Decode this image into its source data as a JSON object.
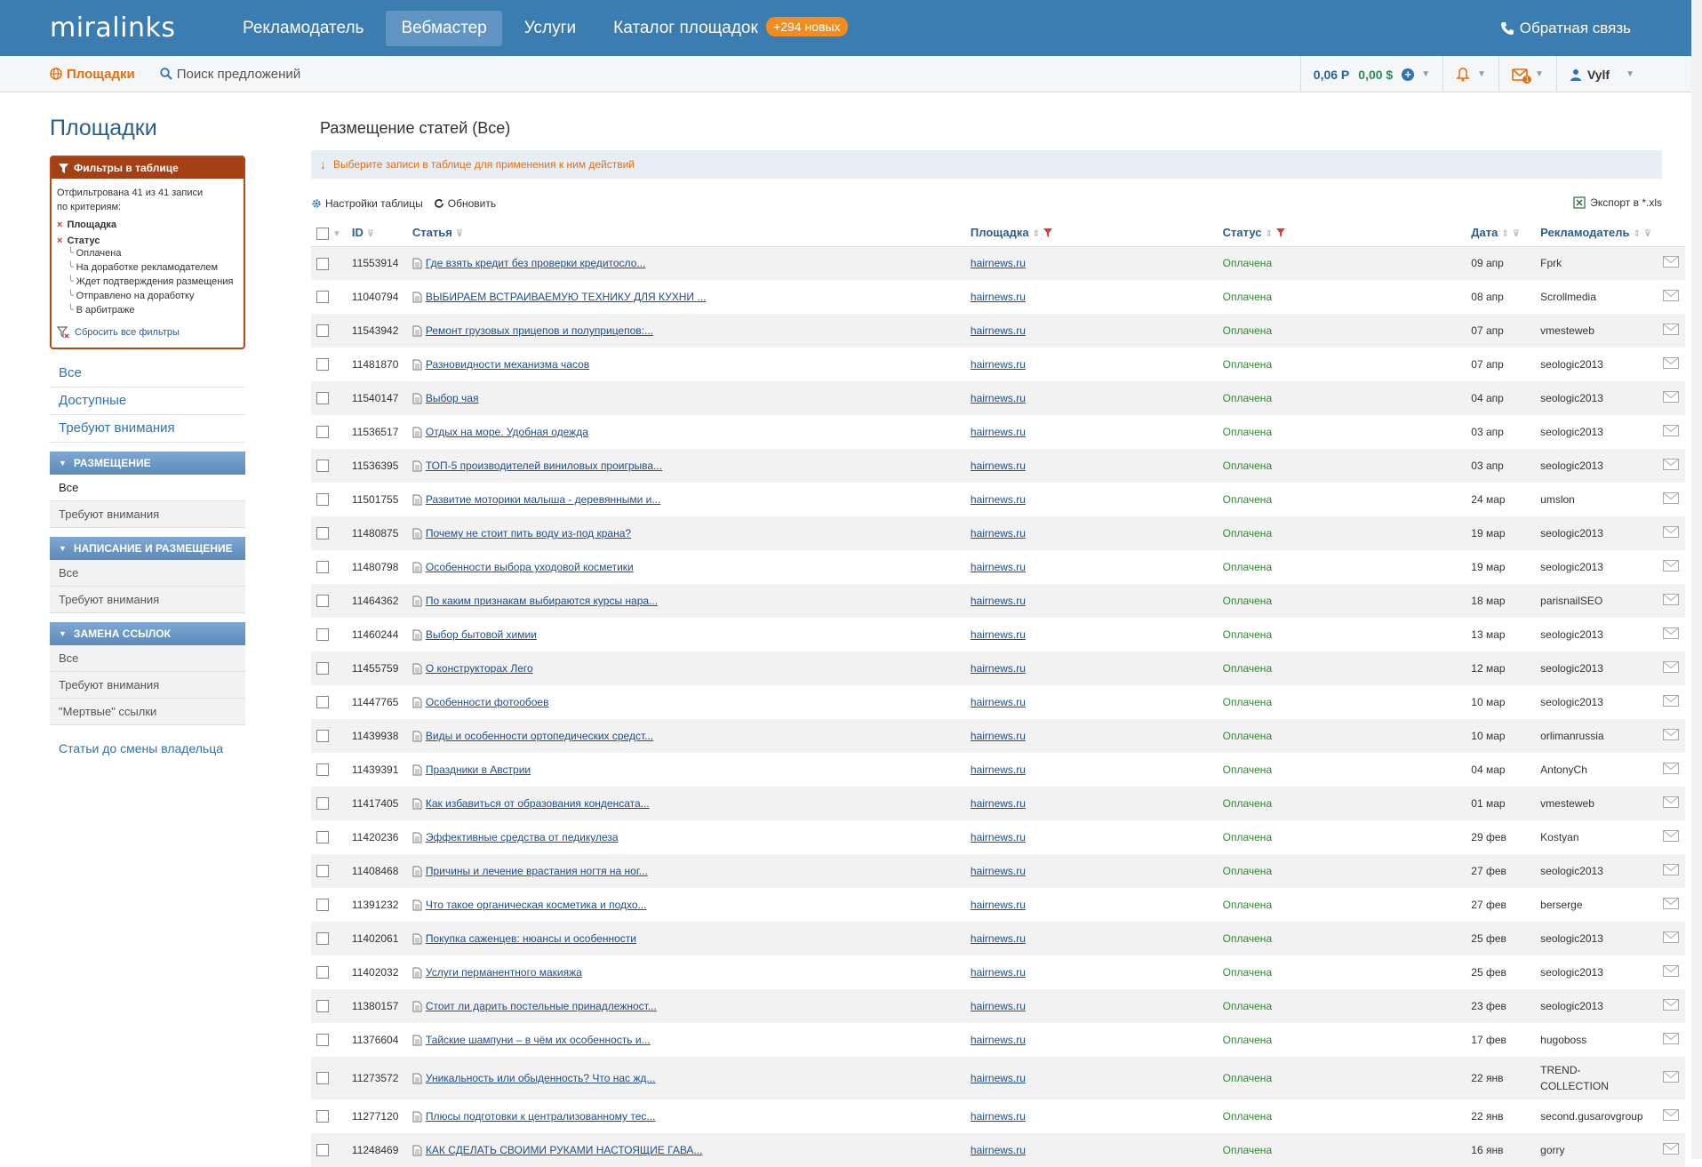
{
  "top": {
    "logo": "miralinks",
    "nav": [
      {
        "label": "Рекламодатель",
        "active": false
      },
      {
        "label": "Вебмастер",
        "active": true
      },
      {
        "label": "Услуги",
        "active": false
      },
      {
        "label": "Каталог площадок",
        "active": false
      }
    ],
    "catalog_badge": "+294 новых",
    "feedback": "Обратная связь"
  },
  "subnav": {
    "sites": "Площадки",
    "search": "Поиск предложений",
    "balance_rub": "0,06 Р",
    "balance_usd": "0,00 $",
    "mail_count": "1",
    "user": "Vylf"
  },
  "sidebar": {
    "title": "Площадки",
    "filter": {
      "title": "Фильтры в таблице",
      "info_line1": "Отфильтрована 41 из 41 записи",
      "info_line2": "по критериям:",
      "criterion1": "Площадка",
      "criterion2": "Статус",
      "statuses": [
        "Оплачена",
        "На доработке рекламодателем",
        "Ждет подтверждения размещения",
        "Отправлено на доработку",
        "В арбитраже"
      ],
      "reset": "Сбросить все фильтры"
    },
    "links": [
      "Все",
      "Доступные",
      "Требуют внимания"
    ],
    "groups": [
      {
        "title": "Размещение",
        "items": [
          "Все",
          "Требуют внимания"
        ]
      },
      {
        "title": "Написание и размещение",
        "items": [
          "Все",
          "Требуют внимания"
        ]
      },
      {
        "title": "Замена ссылок",
        "items": [
          "Все",
          "Требуют внимания",
          "\"Мертвые\" ссылки"
        ]
      }
    ],
    "extra_link": "Статьи до смены владельца"
  },
  "main": {
    "title": "Размещение статей (Все)",
    "hint": "Выберите записи в таблице для применения к ним действий",
    "table_settings": "Настройки таблицы",
    "refresh": "Обновить",
    "export": "Экспорт в *.xls",
    "columns": {
      "id": "ID",
      "article": "Статья",
      "site": "Площадка",
      "status": "Статус",
      "date": "Дата",
      "advertiser": "Рекламодатель"
    },
    "rows": [
      {
        "id": "11553914",
        "article": "Где взять кредит без проверки кредитосло...",
        "site": "hairnews.ru",
        "status": "Оплачена",
        "date": "09 апр",
        "adv": "Fprk"
      },
      {
        "id": "11040794",
        "article": "ВЫБИРАЕМ ВСТРАИВАЕМУЮ ТЕХНИКУ ДЛЯ КУХНИ ...",
        "site": "hairnews.ru",
        "status": "Оплачена",
        "date": "08 апр",
        "adv": "Scrollmedia"
      },
      {
        "id": "11543942",
        "article": "Ремонт грузовых прицепов и полуприцепов:...",
        "site": "hairnews.ru",
        "status": "Оплачена",
        "date": "07 апр",
        "adv": "vmesteweb"
      },
      {
        "id": "11481870",
        "article": "Разновидности механизма часов",
        "site": "hairnews.ru",
        "status": "Оплачена",
        "date": "07 апр",
        "adv": "seologic2013"
      },
      {
        "id": "11540147",
        "article": "Выбор чая",
        "site": "hairnews.ru",
        "status": "Оплачена",
        "date": "04 апр",
        "adv": "seologic2013"
      },
      {
        "id": "11536517",
        "article": "Отдых на море. Удобная одежда",
        "site": "hairnews.ru",
        "status": "Оплачена",
        "date": "03 апр",
        "adv": "seologic2013"
      },
      {
        "id": "11536395",
        "article": "ТОП-5 производителей виниловых проигрыва...",
        "site": "hairnews.ru",
        "status": "Оплачена",
        "date": "03 апр",
        "adv": "seologic2013"
      },
      {
        "id": "11501755",
        "article": "Развитие моторики малыша - деревянными и...",
        "site": "hairnews.ru",
        "status": "Оплачена",
        "date": "24 мар",
        "adv": "umslon"
      },
      {
        "id": "11480875",
        "article": "Почему не стоит пить воду из-под крана?",
        "site": "hairnews.ru",
        "status": "Оплачена",
        "date": "19 мар",
        "adv": "seologic2013"
      },
      {
        "id": "11480798",
        "article": "Особенности выбора уходовой косметики",
        "site": "hairnews.ru",
        "status": "Оплачена",
        "date": "19 мар",
        "adv": "seologic2013"
      },
      {
        "id": "11464362",
        "article": "По каким признакам выбираются курсы нара...",
        "site": "hairnews.ru",
        "status": "Оплачена",
        "date": "18 мар",
        "adv": "parisnailSEO"
      },
      {
        "id": "11460244",
        "article": "Выбор бытовой химии",
        "site": "hairnews.ru",
        "status": "Оплачена",
        "date": "13 мар",
        "adv": "seologic2013"
      },
      {
        "id": "11455759",
        "article": "О конструкторах Лего",
        "site": "hairnews.ru",
        "status": "Оплачена",
        "date": "12 мар",
        "adv": "seologic2013"
      },
      {
        "id": "11447765",
        "article": "Особенности фотообоев",
        "site": "hairnews.ru",
        "status": "Оплачена",
        "date": "10 мар",
        "adv": "seologic2013"
      },
      {
        "id": "11439938",
        "article": "Виды и особенности ортопедических средст...",
        "site": "hairnews.ru",
        "status": "Оплачена",
        "date": "10 мар",
        "adv": "orlimanrussia"
      },
      {
        "id": "11439391",
        "article": "Праздники в Австрии",
        "site": "hairnews.ru",
        "status": "Оплачена",
        "date": "04 мар",
        "adv": "AntonyCh"
      },
      {
        "id": "11417405",
        "article": "Как избавиться от образования конденсата...",
        "site": "hairnews.ru",
        "status": "Оплачена",
        "date": "01 мар",
        "adv": "vmesteweb"
      },
      {
        "id": "11420236",
        "article": "Эффективные средства от педикулеза",
        "site": "hairnews.ru",
        "status": "Оплачена",
        "date": "29 фев",
        "adv": "Kostyan"
      },
      {
        "id": "11408468",
        "article": "Причины и лечение врастания ногтя на ног...",
        "site": "hairnews.ru",
        "status": "Оплачена",
        "date": "27 фев",
        "adv": "seologic2013"
      },
      {
        "id": "11391232",
        "article": "Что такое органическая косметика и подхо...",
        "site": "hairnews.ru",
        "status": "Оплачена",
        "date": "27 фев",
        "adv": "berserge"
      },
      {
        "id": "11402061",
        "article": "Покупка саженцев: нюансы и особенности",
        "site": "hairnews.ru",
        "status": "Оплачена",
        "date": "25 фев",
        "adv": "seologic2013"
      },
      {
        "id": "11402032",
        "article": "Услуги перманентного макияжа",
        "site": "hairnews.ru",
        "status": "Оплачена",
        "date": "25 фев",
        "adv": "seologic2013"
      },
      {
        "id": "11380157",
        "article": "Стоит ли дарить постельные принадлежност...",
        "site": "hairnews.ru",
        "status": "Оплачена",
        "date": "23 фев",
        "adv": "seologic2013"
      },
      {
        "id": "11376604",
        "article": "Тайские шампуни – в чём их особенность и...",
        "site": "hairnews.ru",
        "status": "Оплачена",
        "date": "17 фев",
        "adv": "hugoboss"
      },
      {
        "id": "11273572",
        "article": "Уникальность или обыденность? Что нас жд...",
        "site": "hairnews.ru",
        "status": "Оплачена",
        "date": "22 янв",
        "adv": "TREND-\nCOLLECTION"
      },
      {
        "id": "11277120",
        "article": "Плюсы подготовки к централизованному тес...",
        "site": "hairnews.ru",
        "status": "Оплачена",
        "date": "22 янв",
        "adv": "second.gusarovgroup"
      },
      {
        "id": "11248469",
        "article": "КАК СДЕЛАТЬ СВОИМИ РУКАМИ НАСТОЯЩИЕ ГАВА...",
        "site": "hairnews.ru",
        "status": "Оплачена",
        "date": "16 янв",
        "adv": "gorry"
      }
    ]
  }
}
